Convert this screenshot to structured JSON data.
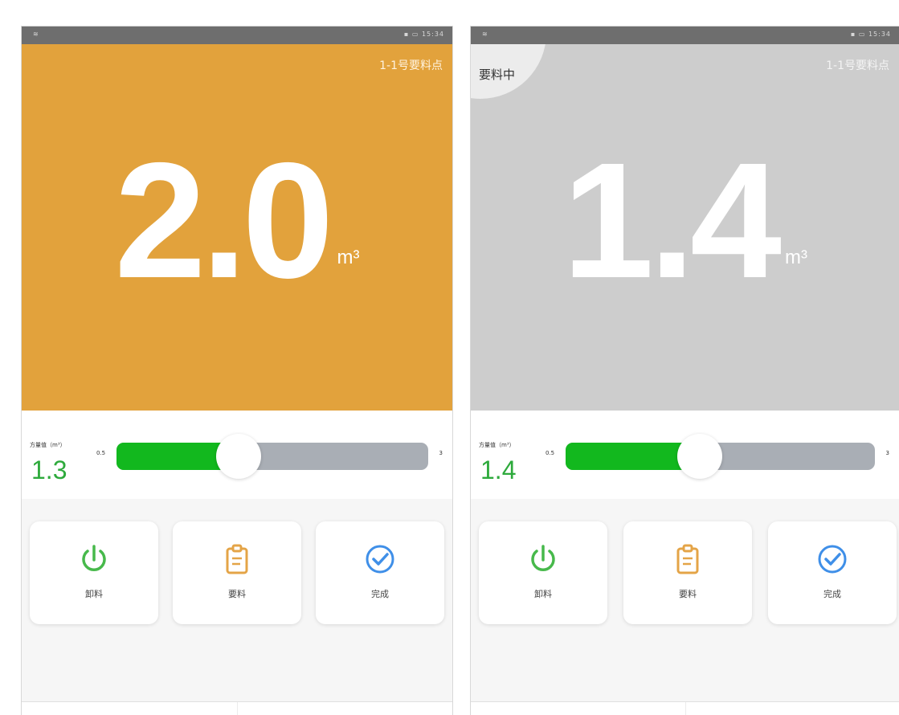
{
  "unit": "m³",
  "screens": [
    {
      "status_left": "≋",
      "status_right": "▪ ▭ 15:34",
      "station": "1-1号要料点",
      "bg_color": "#e2a23c",
      "value": "2.0",
      "badge": null,
      "volume_label": "方量值（m³）",
      "volume_value": "1.3",
      "slider": {
        "min": "0.5",
        "max": "3",
        "min_value": 0.5,
        "max_value": 3,
        "current": 1.3
      },
      "actions": [
        {
          "label": "卸料",
          "icon": "power-icon",
          "color": "#47b94b"
        },
        {
          "label": "要料",
          "icon": "clipboard-icon",
          "color": "#e4a447"
        },
        {
          "label": "完成",
          "icon": "check-circle-icon",
          "color": "#3f8fe8"
        }
      ],
      "nav": [
        "dispatch-icon",
        "user-icon"
      ]
    },
    {
      "status_left": "≋",
      "status_right": "▪ ▭ 15:34",
      "station": "1-1号要料点",
      "bg_color": "#cdcdcd",
      "value": "1.4",
      "badge": "要料中",
      "volume_label": "方量值（m³）",
      "volume_value": "1.4",
      "slider": {
        "min": "0.5",
        "max": "3",
        "min_value": 0.5,
        "max_value": 3,
        "current": 1.4
      },
      "actions": [
        {
          "label": "卸料",
          "icon": "power-icon",
          "color": "#47b94b"
        },
        {
          "label": "要料",
          "icon": "clipboard-icon",
          "color": "#e4a447"
        },
        {
          "label": "完成",
          "icon": "check-circle-icon",
          "color": "#3f8fe8"
        }
      ],
      "nav": [
        "dispatch-icon",
        "user-icon"
      ]
    }
  ],
  "colors": {
    "accent_green": "#12b81e",
    "value_green": "#2eaa3c",
    "nav_blue": "#3f8fe8"
  }
}
